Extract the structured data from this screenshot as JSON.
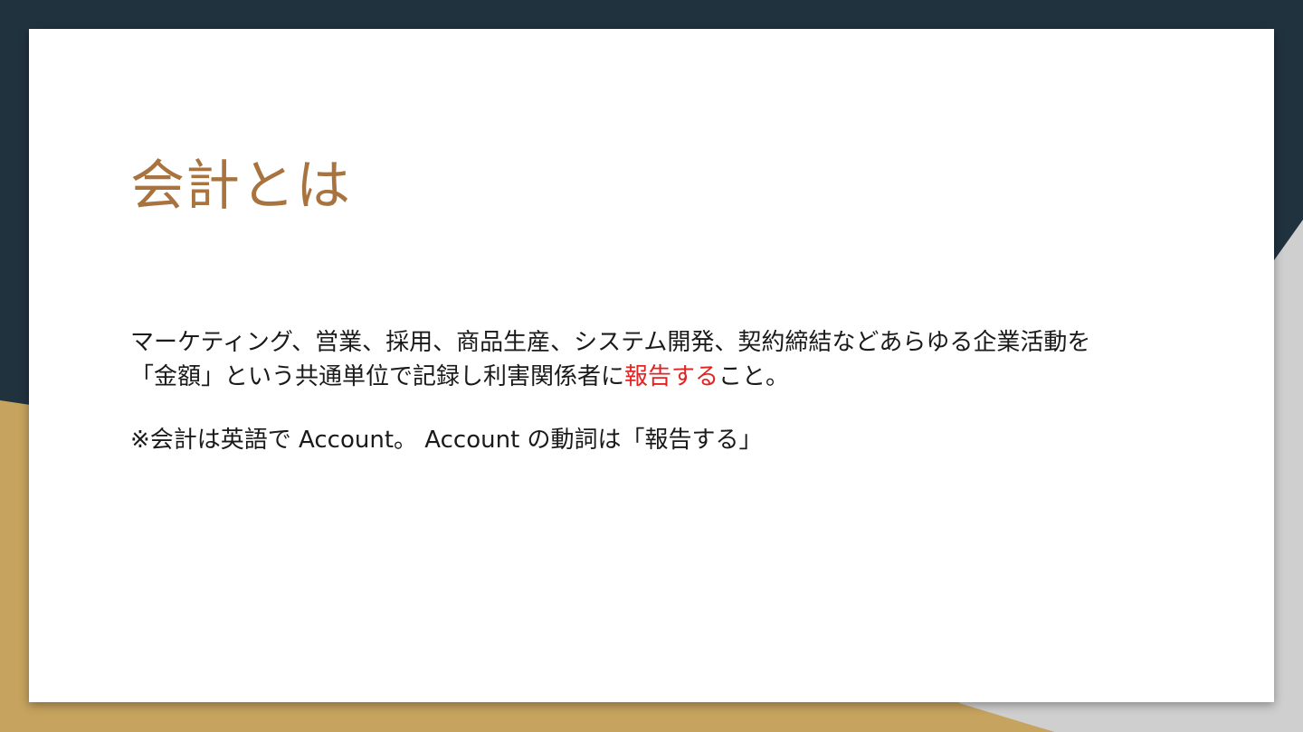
{
  "slide": {
    "title": "会計とは",
    "body": {
      "line1": "マーケティング、営業、採用、商品生産、システム開発、契約締結などあらゆる企業活動を",
      "line2_before": "「金額」という共通単位で記録し利害関係者に",
      "line2_highlight": "報告する",
      "line2_after": "こと。"
    },
    "note": "※会計は英語で Account。 Account の動詞は「報告する」"
  },
  "colors": {
    "background_dark": "#21323f",
    "background_gold": "#c6a35e",
    "background_gray": "#cfcfcf",
    "slide": "#ffffff",
    "title": "#a8733f",
    "text": "#1a1a1a",
    "highlight": "#e32222"
  }
}
